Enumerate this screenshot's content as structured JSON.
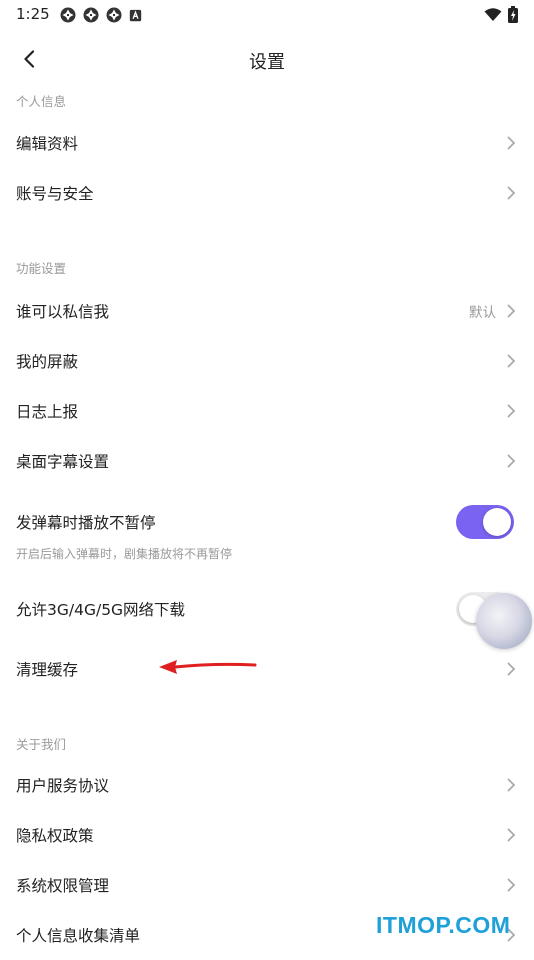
{
  "status_bar": {
    "time": "1:25",
    "notification_icons": [
      "aperture-icon",
      "aperture-icon",
      "aperture-icon",
      "a-box-icon"
    ],
    "right_icons": [
      "wifi-icon",
      "battery-charging-icon"
    ]
  },
  "header": {
    "title": "设置",
    "back_icon": "chevron-left-icon"
  },
  "sections": {
    "personal": {
      "title": "个人信息",
      "items": [
        "编辑资料",
        "账号与安全"
      ]
    },
    "features": {
      "title": "功能设置",
      "who_can_message": {
        "label": "谁可以私信我",
        "value": "默认"
      },
      "items": [
        "我的屏蔽",
        "日志上报",
        "桌面字幕设置"
      ],
      "danmaku_toggle": {
        "label": "发弹幕时播放不暂停",
        "description": "开启后输入弹幕时，剧集播放将不再暂停",
        "enabled": true
      },
      "network_toggle": {
        "label": "允许3G/4G/5G网络下载",
        "enabled": false
      },
      "clear_cache": {
        "label": "清理缓存"
      }
    },
    "about": {
      "title": "关于我们",
      "items": [
        "用户服务协议",
        "隐私权政策",
        "系统权限管理",
        "个人信息收集清单"
      ]
    }
  },
  "watermark": "ITMOP.COM",
  "colors": {
    "accent": "#7a63f1",
    "text": "#222222",
    "muted": "#9a9a9a",
    "watermark": "#1ea0d8",
    "annotation_arrow": "#e02020"
  }
}
